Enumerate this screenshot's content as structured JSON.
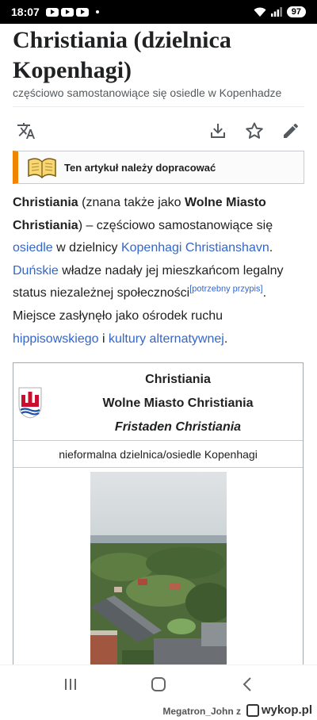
{
  "status_bar": {
    "time": "18:07",
    "battery": "97"
  },
  "page": {
    "title": "Christiania (dzielnica Kopenhagi)",
    "subtitle": "częściowo samostanowiące się osiedle w Kopenhadze"
  },
  "actions": {
    "translate_icon": "translate-icon",
    "download_icon": "download-icon",
    "star_icon": "star-icon",
    "edit_icon": "pencil-icon"
  },
  "notice": {
    "text": "Ten artykuł należy dopracować",
    "accent": "#f28500"
  },
  "intro": {
    "p1_bold1": "Christiania",
    "p1_t1": " (znana także jako ",
    "p1_bold2": "Wolne Miasto Christiania",
    "p1_t2": ") – częściowo samostanowiące się ",
    "link_osiedle": "osiedle",
    "p1_t3": " w dzielnicy ",
    "link_district": "Kopenhagi Christianshavn",
    "p1_t4": ". ",
    "link_danish": "Duńskie",
    "p1_t5": " władze nadały jej mieszkańcom legalny status niezależnej społeczności",
    "citation_needed": "[potrzebny przypis]",
    "p1_t6": ". Miejsce zasłynęło jako ośrodek ruchu ",
    "link_hippie": "hippisowskiego",
    "p1_t7": " i ",
    "link_culture": "kultury alternatywnej",
    "p1_t8": "."
  },
  "infobox": {
    "name": "Christiania",
    "name_alt": "Wolne Miasto Christiania",
    "name_local": "Fristaden Christiania",
    "type": "nieformalna dzielnica/osiedle Kopenhagi"
  },
  "watermark": {
    "user": "Megatron_John z",
    "site": "wykop.pl"
  },
  "colors": {
    "link": "#3366cc",
    "text": "#202122"
  }
}
